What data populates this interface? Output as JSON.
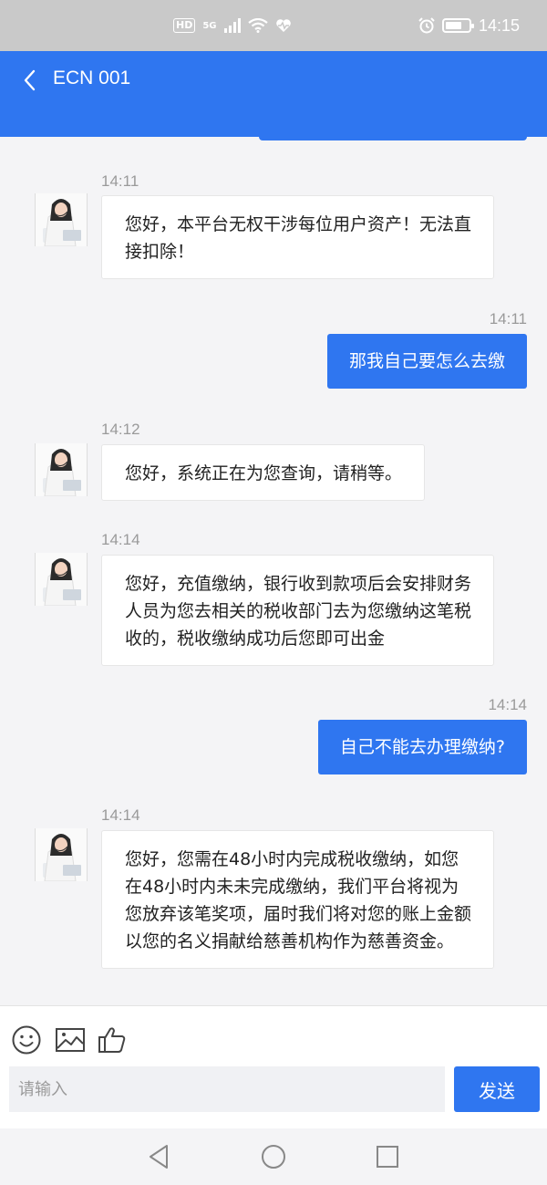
{
  "status_bar": {
    "hd": "HD",
    "signal": "5G",
    "time": "14:15",
    "battery_level": 0.7
  },
  "header": {
    "title": "ECN 001"
  },
  "messages": [
    {
      "time": "14:11",
      "side": "in",
      "text_lines": [
        "您好，本平台无权干涉每位用户资产！无法直",
        "接扣除！"
      ]
    },
    {
      "time": "14:11",
      "side": "out",
      "text_lines": [
        "那我自己要怎么去缴"
      ]
    },
    {
      "time": "14:12",
      "side": "in",
      "text_lines": [
        "您好，系统正在为您查询，请稍等。"
      ]
    },
    {
      "time": "14:14",
      "side": "in",
      "text_lines": [
        "您好，充值缴纳，银行收到款项后会安排财务",
        "人员为您去相关的税收部门去为您缴纳这笔税",
        "收的，税收缴纳成功后您即可出金"
      ]
    },
    {
      "time": "14:14",
      "side": "out",
      "text_lines": [
        "自己不能去办理缴纳?"
      ]
    },
    {
      "time": "14:14",
      "side": "in",
      "text_lines": [
        "您好，您需在48小时内完成税收缴纳，如您",
        "在48小时内未未完成缴纳，我们平台将视为",
        "您放弃该笔奖项，届时我们将对您的账上金额",
        "以您的名义捐献给慈善机构作为慈善资金。"
      ]
    }
  ],
  "input": {
    "placeholder": "请输入",
    "send_label": "发送"
  },
  "icons": {
    "emoji": "emoji-icon",
    "image": "image-icon",
    "like": "thumbs-up-icon"
  },
  "colors": {
    "accent": "#2f76f0",
    "status_bar": "#c9c9c9",
    "background": "#f4f4f6"
  }
}
